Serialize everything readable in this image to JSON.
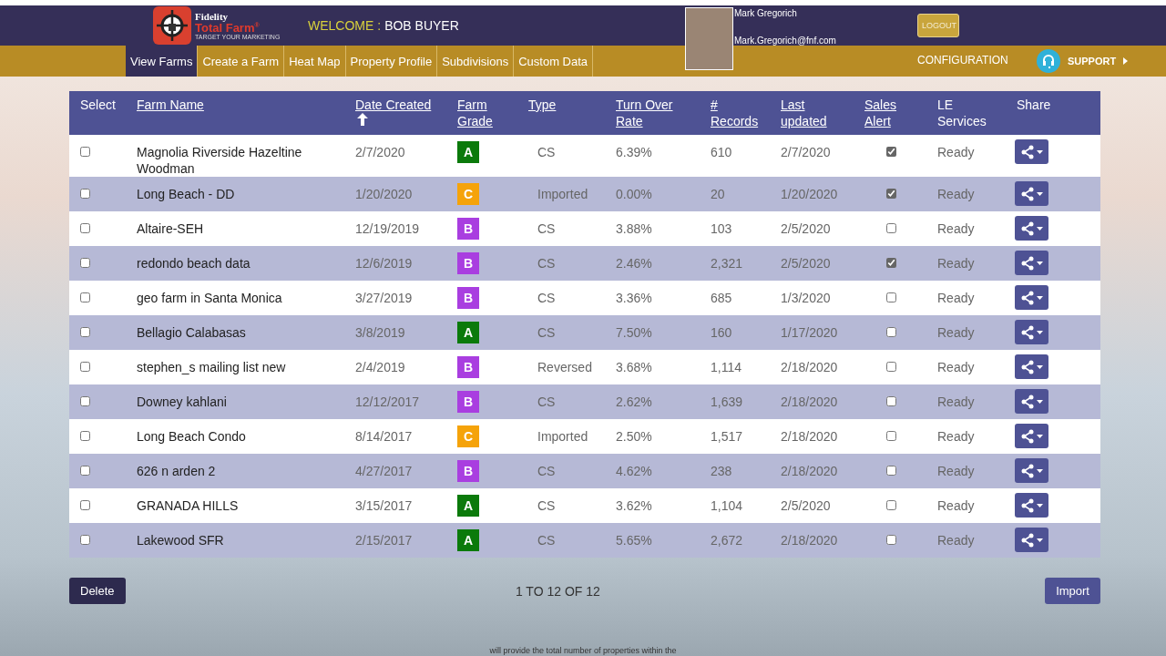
{
  "brand": {
    "line1": "Fidelity",
    "line2": "Total Farm",
    "mark": "®",
    "tagline": "TARGET YOUR MARKETING"
  },
  "welcome": {
    "label": "WELCOME :",
    "name": "BOB BUYER"
  },
  "user": {
    "name": "Mark  Gregorich",
    "email": "Mark.Gregorich@fnf.com"
  },
  "logout": "LOGOUT",
  "nav": [
    {
      "label": "View Farms",
      "selected": true
    },
    {
      "label": "Create a Farm",
      "selected": false
    },
    {
      "label": "Heat Map",
      "selected": false
    },
    {
      "label": "Property Profile",
      "selected": false
    },
    {
      "label": "Subdivisions",
      "selected": false
    },
    {
      "label": "Custom Data",
      "selected": false
    }
  ],
  "configuration": "CONFIGURATION",
  "support": "SUPPORT",
  "table": {
    "columns": [
      {
        "label": "Select",
        "link": false,
        "sorted": false
      },
      {
        "label": "Farm Name",
        "link": true,
        "sorted": false
      },
      {
        "label": "Date Created",
        "link": true,
        "sorted": true
      },
      {
        "label": "Farm Grade",
        "link": true,
        "sorted": false
      },
      {
        "label": "Type",
        "link": true,
        "sorted": false
      },
      {
        "label": "Turn Over Rate",
        "link": true,
        "sorted": false
      },
      {
        "label": "# Records",
        "link": true,
        "sorted": false
      },
      {
        "label": "Last updated",
        "link": true,
        "sorted": false
      },
      {
        "label": "Sales Alert",
        "link": true,
        "sorted": false
      },
      {
        "label": "LE Services",
        "link": false,
        "sorted": false
      },
      {
        "label": "Share",
        "link": false,
        "sorted": false
      }
    ],
    "rows": [
      {
        "selected": false,
        "name": "Magnolia Riverside Hazeltine Woodman",
        "date": "2/7/2020",
        "grade": "A",
        "color": "#0b7a0b",
        "type": "CS",
        "rate": "6.39%",
        "records": "610",
        "updated": "2/7/2020",
        "alert": true,
        "le": "Ready"
      },
      {
        "selected": false,
        "name": "Long Beach - DD",
        "date": "1/20/2020",
        "grade": "C",
        "color": "#f5a30a",
        "type": "Imported",
        "rate": "0.00%",
        "records": "20",
        "updated": "1/20/2020",
        "alert": true,
        "le": "Ready"
      },
      {
        "selected": false,
        "name": "Altaire-SEH",
        "date": "12/19/2019",
        "grade": "B",
        "color": "#a93ee0",
        "type": "CS",
        "rate": "3.88%",
        "records": "103",
        "updated": "2/5/2020",
        "alert": false,
        "le": "Ready"
      },
      {
        "selected": false,
        "name": "redondo beach data",
        "date": "12/6/2019",
        "grade": "B",
        "color": "#a93ee0",
        "type": "CS",
        "rate": "2.46%",
        "records": "2,321",
        "updated": "2/5/2020",
        "alert": true,
        "le": "Ready"
      },
      {
        "selected": false,
        "name": "geo farm in Santa Monica",
        "date": "3/27/2019",
        "grade": "B",
        "color": "#a93ee0",
        "type": "CS",
        "rate": "3.36%",
        "records": "685",
        "updated": "1/3/2020",
        "alert": false,
        "le": "Ready"
      },
      {
        "selected": false,
        "name": "Bellagio Calabasas",
        "date": "3/8/2019",
        "grade": "A",
        "color": "#0b7a0b",
        "type": "CS",
        "rate": "7.50%",
        "records": "160",
        "updated": "1/17/2020",
        "alert": false,
        "le": "Ready"
      },
      {
        "selected": false,
        "name": "stephen_s mailing list new",
        "date": "2/4/2019",
        "grade": "B",
        "color": "#a93ee0",
        "type": "Reversed",
        "rate": "3.68%",
        "records": "1,114",
        "updated": "2/18/2020",
        "alert": false,
        "le": "Ready"
      },
      {
        "selected": false,
        "name": "Downey kahlani",
        "date": "12/12/2017",
        "grade": "B",
        "color": "#a93ee0",
        "type": "CS",
        "rate": "2.62%",
        "records": "1,639",
        "updated": "2/18/2020",
        "alert": false,
        "le": "Ready"
      },
      {
        "selected": false,
        "name": "Long Beach Condo",
        "date": "8/14/2017",
        "grade": "C",
        "color": "#f5a30a",
        "type": "Imported",
        "rate": "2.50%",
        "records": "1,517",
        "updated": "2/18/2020",
        "alert": false,
        "le": "Ready"
      },
      {
        "selected": false,
        "name": "626 n arden 2",
        "date": "4/27/2017",
        "grade": "B",
        "color": "#a93ee0",
        "type": "CS",
        "rate": "4.62%",
        "records": "238",
        "updated": "2/18/2020",
        "alert": false,
        "le": "Ready"
      },
      {
        "selected": false,
        "name": "GRANADA HILLS",
        "date": "3/15/2017",
        "grade": "A",
        "color": "#0b7a0b",
        "type": "CS",
        "rate": "3.62%",
        "records": "1,104",
        "updated": "2/5/2020",
        "alert": false,
        "le": "Ready"
      },
      {
        "selected": false,
        "name": "Lakewood SFR",
        "date": "2/15/2017",
        "grade": "A",
        "color": "#0b7a0b",
        "type": "CS",
        "rate": "5.65%",
        "records": "2,672",
        "updated": "2/18/2020",
        "alert": false,
        "le": "Ready"
      }
    ]
  },
  "delete": "Delete",
  "pagination": "1 TO 12 OF 12",
  "import": "Import",
  "footer_text": "will provide the total number of properties within the"
}
